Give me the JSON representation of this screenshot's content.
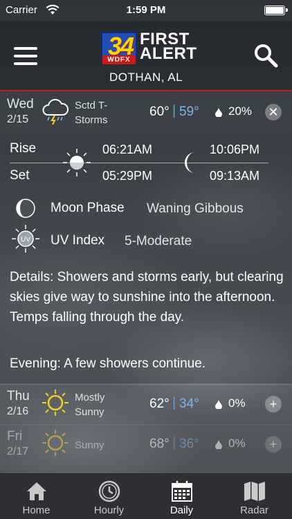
{
  "status_bar": {
    "carrier": "Carrier",
    "time": "1:59 PM"
  },
  "header": {
    "logo_number": "34",
    "logo_call_sign": "WDFX",
    "logo_brand_line1": "FIRST",
    "logo_brand_line2": "ALERT",
    "location": "DOTHAN, AL"
  },
  "days": [
    {
      "day": "Wed",
      "date": "2/15",
      "condition_line1": "Sctd T-",
      "condition_line2": "Storms",
      "icon": "thunderstorm-cloud-icon",
      "high": "60°",
      "low": "59°",
      "precip": "20%",
      "action": "close"
    },
    {
      "day": "Thu",
      "date": "2/16",
      "condition_line1": "Mostly",
      "condition_line2": "Sunny",
      "icon": "sun-icon",
      "high": "62°",
      "low": "34°",
      "precip": "0%",
      "action": "expand"
    },
    {
      "day": "Fri",
      "date": "2/17",
      "condition_line1": "Sunny",
      "condition_line2": "",
      "icon": "sun-icon",
      "high": "68°",
      "low": "36°",
      "precip": "0%",
      "action": "expand"
    }
  ],
  "separator": "|",
  "details": {
    "rise_label": "Rise",
    "set_label": "Set",
    "sunrise": "06:21AM",
    "sunset": "05:29PM",
    "moonrise": "10:06PM",
    "moonset": "09:13AM",
    "moon_phase_label": "Moon Phase",
    "moon_phase_value": "Waning Gibbous",
    "uv_badge": "UV",
    "uv_label": "UV Index",
    "uv_value": "5-Moderate",
    "details_text": "Details: Showers and storms early, but clearing skies give way to sunshine into the afternoon. Temps falling through the day.",
    "evening_text": "Evening: A few showers continue."
  },
  "buttons": {
    "close_symbol": "✕",
    "expand_symbol": "+"
  },
  "tabs": [
    {
      "label": "Home",
      "icon": "home-icon"
    },
    {
      "label": "Hourly",
      "icon": "clock-icon"
    },
    {
      "label": "Daily",
      "icon": "calendar-icon",
      "selected": true
    },
    {
      "label": "Radar",
      "icon": "map-icon"
    }
  ],
  "colors": {
    "low_temp": "#7fb6e8",
    "header_border": "#b02020",
    "logo_blue": "#1f4fb5",
    "logo_yellow": "#ffd400",
    "sun_yellow": "#f5d020"
  }
}
